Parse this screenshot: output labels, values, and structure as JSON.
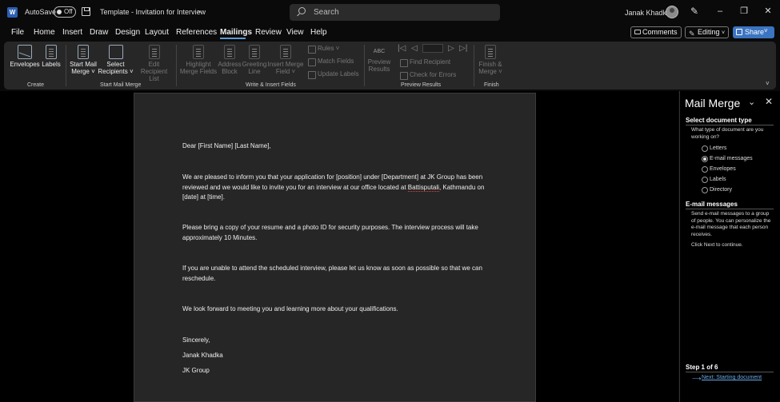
{
  "titlebar": {
    "autosave_label": "AutoSave",
    "autosave_state": "Off",
    "doc_title": "Template - Invitation for Interview",
    "search_placeholder": "Search",
    "user_name": "Janak Khadka"
  },
  "menu": {
    "items": [
      "File",
      "Home",
      "Insert",
      "Draw",
      "Design",
      "Layout",
      "References",
      "Mailings",
      "Review",
      "View",
      "Help"
    ],
    "active": "Mailings",
    "comments_label": "Comments",
    "editing_label": "Editing",
    "share_label": "Share"
  },
  "ribbon": {
    "create": {
      "group_label": "Create",
      "envelopes": "Envelopes",
      "labels": "Labels"
    },
    "start_mail_merge": {
      "group_label": "Start Mail Merge",
      "start_line1": "Start Mail",
      "start_line2": "Merge ˅",
      "select_line1": "Select",
      "select_line2": "Recipients ˅",
      "edit_line1": "Edit",
      "edit_line2": "Recipient List"
    },
    "write_insert": {
      "group_label": "Write & Insert Fields",
      "highlight_line1": "Highlight",
      "highlight_line2": "Merge Fields",
      "address_line1": "Address",
      "address_line2": "Block",
      "greeting_line1": "Greeting",
      "greeting_line2": "Line",
      "insert_line1": "Insert Merge",
      "insert_line2": "Field ˅",
      "rules": "Rules ˅",
      "match_fields": "Match Fields",
      "update_labels": "Update Labels"
    },
    "preview": {
      "group_label": "Preview Results",
      "abc": "ABC",
      "preview_line1": "Preview",
      "preview_line2": "Results",
      "find_recipient": "Find Recipient",
      "check_errors": "Check for Errors"
    },
    "finish": {
      "group_label": "Finish",
      "finish_line1": "Finish &",
      "finish_line2": "Merge ˅"
    }
  },
  "document": {
    "salutation": "Dear [First Name] [Last Name],",
    "p1_a": "We are pleased to inform you that your application for [position] under [Department] at JK Group has been reviewed and we would like to invite you for an interview at our office located at ",
    "p1_place": "Battisputali",
    "p1_b": ", Kathmandu on [date] at [time].",
    "p2": "Please bring a copy of your resume and a photo ID for security purposes. The interview process will take approximately 10 Minutes.",
    "p3": "If you are unable to attend the scheduled interview, please let us know as soon as possible so that we can reschedule.",
    "p4": "We look forward to meeting you and learning more about your qualifications.",
    "closing": "Sincerely,",
    "sign_name": "Janak Khadka",
    "sign_company": "JK Group"
  },
  "pane": {
    "title": "Mail Merge",
    "select_heading": "Select document type",
    "select_question": "What type of document are you working on?",
    "options": [
      "Letters",
      "E-mail messages",
      "Envelopes",
      "Labels",
      "Directory"
    ],
    "selected_option": "E-mail messages",
    "email_heading": "E-mail messages",
    "email_desc": "Send e-mail messages to a group of people. You can personalize the e-mail message that each person receives.",
    "click_next": "Click Next to continue.",
    "step": "Step 1 of 6",
    "next_link": "Next: Starting document"
  }
}
